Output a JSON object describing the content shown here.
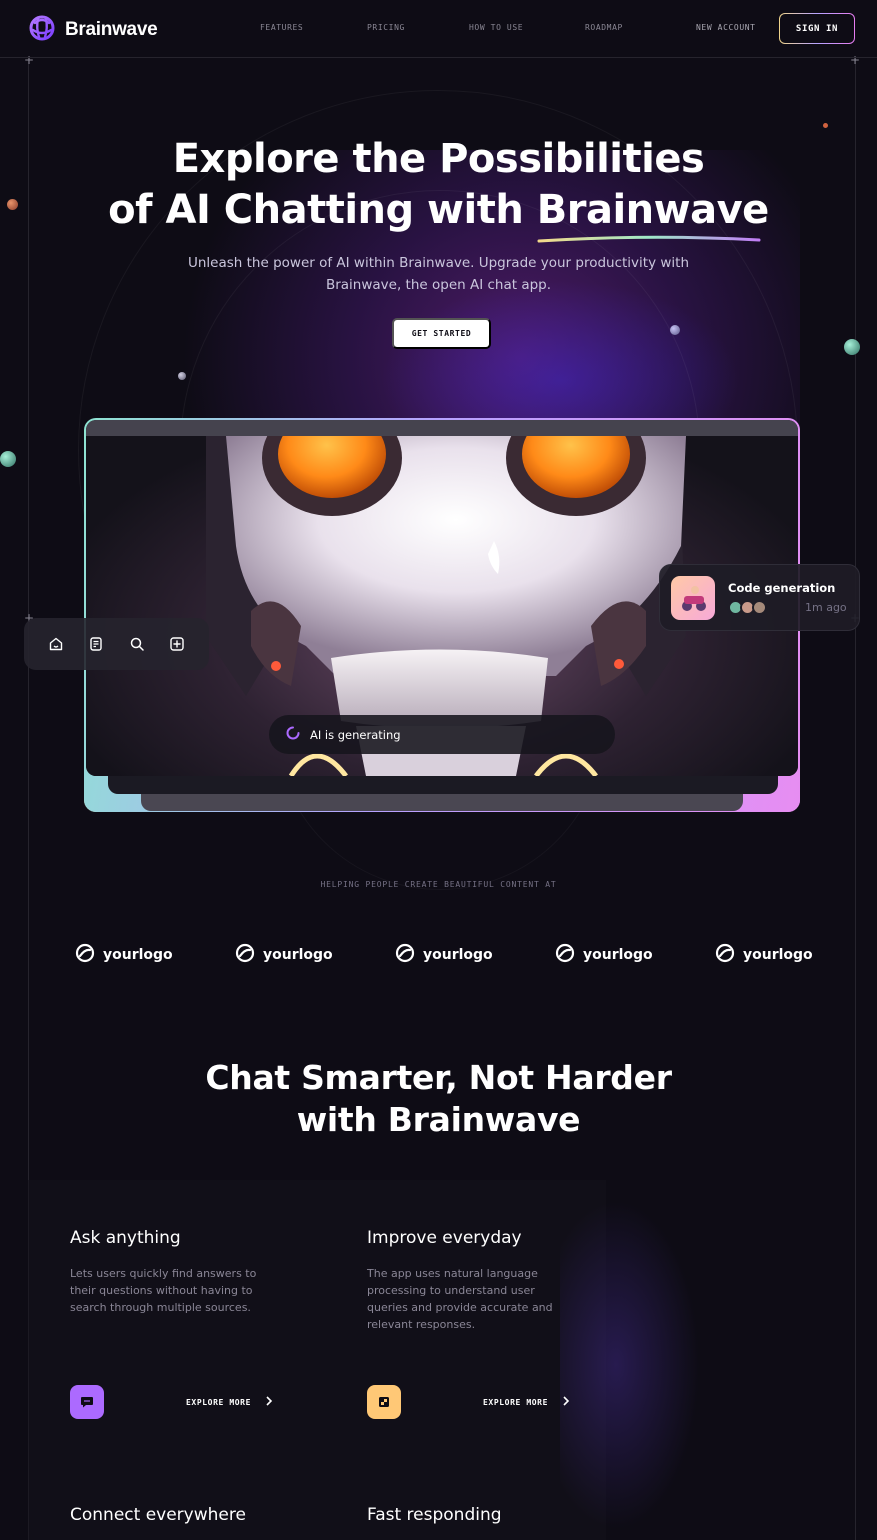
{
  "header": {
    "brand": "Brainwave",
    "nav": [
      "FEATURES",
      "PRICING",
      "HOW TO USE",
      "ROADMAP"
    ],
    "new_account": "NEW ACCOUNT",
    "sign_in": "SIGN IN"
  },
  "hero": {
    "title_line1": "Explore the Possibilities",
    "title_line2_prefix": "of AI Chatting with",
    "title_highlight": "Brainwave",
    "subtitle": "Unleash the power of AI within Brainwave. Upgrade your productivity with Brainwave, the open AI chat app.",
    "cta": "GET STARTED"
  },
  "preview": {
    "status": "AI is generating",
    "card": {
      "title": "Code generation",
      "time": "1m ago"
    },
    "toolbar": [
      "home-icon",
      "document-icon",
      "search-icon",
      "plus-square-icon"
    ]
  },
  "brands": {
    "label": "HELPING PEOPLE CREATE BEAUTIFUL CONTENT AT",
    "logos": [
      "yourlogo",
      "yourlogo",
      "yourlogo",
      "yourlogo",
      "yourlogo"
    ]
  },
  "features": {
    "title_line1": "Chat Smarter, Not Harder",
    "title_line2": "with Brainwave",
    "items": [
      {
        "title": "Ask anything",
        "text": "Lets users quickly find answers to their questions without having to search through multiple sources.",
        "action": "EXPLORE MORE",
        "icon": "chat-icon",
        "color": "#ac6aff"
      },
      {
        "title": "Improve everyday",
        "text": "The app uses natural language processing to understand user queries and provide accurate and relevant responses.",
        "action": "EXPLORE MORE",
        "icon": "puzzle-icon",
        "color": "#ffc876"
      },
      {
        "title": "Connect everywhere"
      },
      {
        "title": "Fast responding"
      }
    ]
  },
  "colors": {
    "background": "#0e0c15",
    "accent_purple": "#ac6aff",
    "accent_yellow": "#ffc876"
  }
}
